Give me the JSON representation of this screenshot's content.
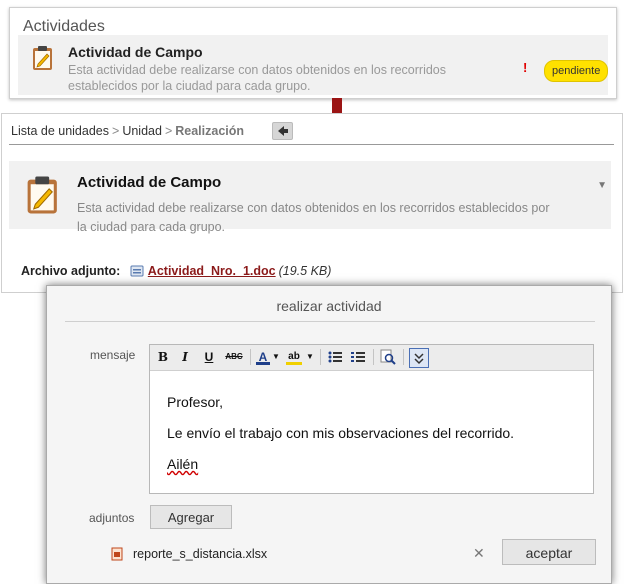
{
  "activities_panel": {
    "title": "Actividades",
    "card": {
      "name": "Actividad de Campo",
      "description": "Esta actividad debe realizarse con datos obtenidos en los recorridos establecidos por la ciudad para cada grupo.",
      "alert": "!",
      "status": "pendiente"
    }
  },
  "detail_panel": {
    "breadcrumb": {
      "item1": "Lista de unidades",
      "item2": "Unidad",
      "current": "Realización",
      "separator": ">"
    },
    "card": {
      "name": "Actividad de Campo",
      "description": "Esta actividad debe realizarse con datos obtenidos en los recorridos establecidos por la ciudad para cada grupo."
    },
    "attachment": {
      "label": "Archivo adjunto:",
      "file": "Actividad_Nro._1.doc",
      "size": "(19.5 KB)"
    }
  },
  "dialog": {
    "title": "realizar actividad",
    "message_label": "mensaje",
    "toolbar": {
      "bold": "B",
      "italic": "I",
      "underline": "U",
      "strike": "ABC",
      "font_color": "A",
      "highlight": "ab"
    },
    "message": {
      "line1": "Profesor,",
      "line2": "Le envío el trabajo con mis observaciones del recorrido.",
      "line3": "Ailén"
    },
    "attachments_label": "adjuntos",
    "add_button": "Agregar",
    "file": "reporte_s_distancia.xlsx",
    "remove": "✕",
    "accept_button": "aceptar"
  },
  "colors": {
    "badge": "#ffe100",
    "arrow": "#9b1414",
    "link": "#8b1a1a",
    "alert": "#e00000"
  },
  "icons": [
    "clipboard-icon",
    "arrow-down-icon",
    "back-arrow-icon",
    "doc-file-icon",
    "spreadsheet-file-icon"
  ]
}
